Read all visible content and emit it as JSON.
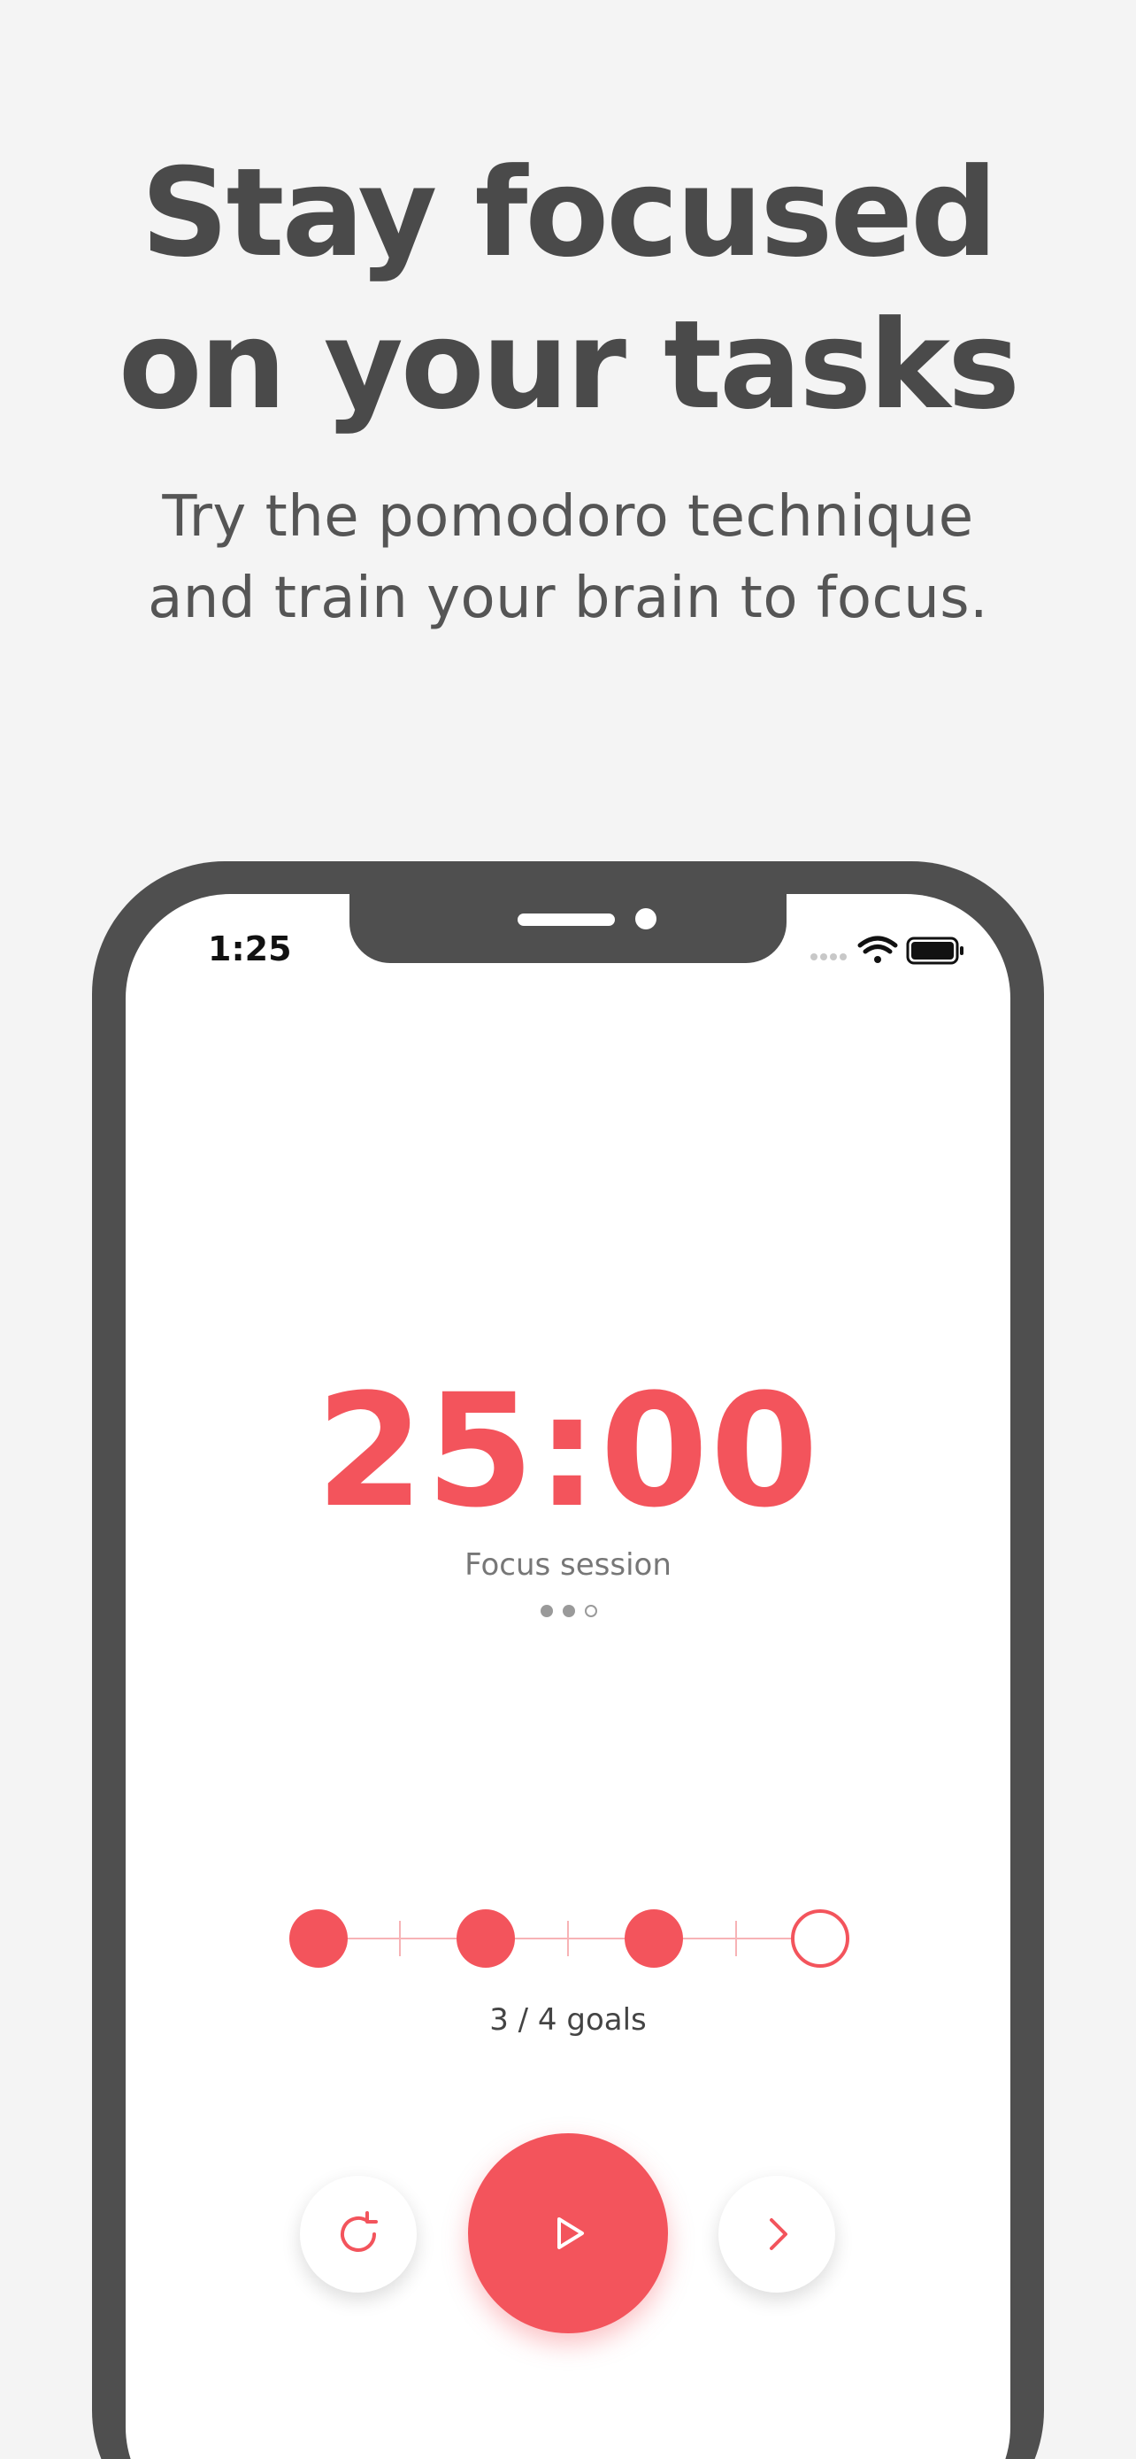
{
  "marketing": {
    "headline_line1": "Stay focused",
    "headline_line2": "on your tasks",
    "subline_line1": "Try the pomodoro technique",
    "subline_line2": "and train your brain to focus."
  },
  "status_bar": {
    "time": "1:25",
    "icons": [
      "signal-icon",
      "wifi-icon",
      "battery-icon"
    ]
  },
  "timer": {
    "value": "25:00",
    "label": "Focus session",
    "session_dots_total": 3,
    "session_dots_filled": 2
  },
  "goals": {
    "completed": 3,
    "total": 4,
    "label": "3 / 4 goals"
  },
  "controls": {
    "reset": "reset-icon",
    "play": "play-icon",
    "skip": "chevron-right-icon"
  },
  "colors": {
    "accent": "#f3545c",
    "frame": "#4f4f4f",
    "background": "#f4f4f4",
    "headline": "#4a4a4a"
  }
}
